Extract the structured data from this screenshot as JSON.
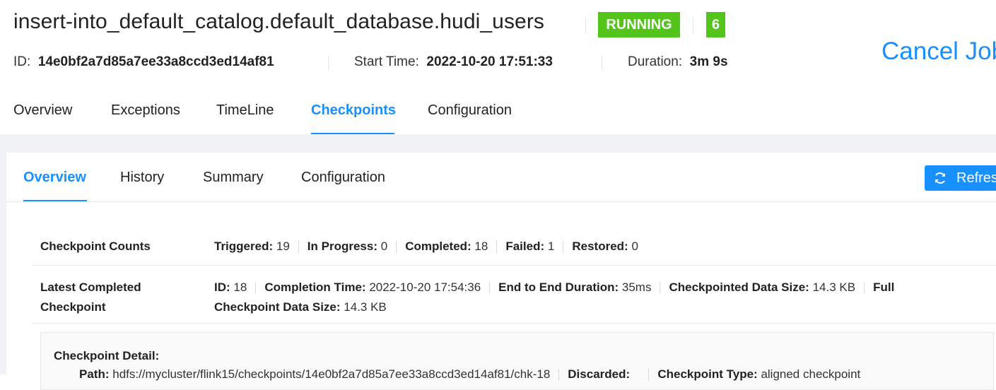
{
  "job": {
    "title": "insert-into_default_catalog.default_database.hudi_users",
    "status": "RUNNING",
    "parallelism": "6",
    "id_label": "ID:",
    "id_value": "14e0bf2a7d85a7ee33a8ccd3ed14af81",
    "start_label": "Start Time:",
    "start_value": "2022-10-20 17:51:33",
    "duration_label": "Duration:",
    "duration_value": "3m 9s",
    "cancel_label": "Cancel Job",
    "status_color": "#52c41a"
  },
  "tabs": [
    "Overview",
    "Exceptions",
    "TimeLine",
    "Checkpoints",
    "Configuration"
  ],
  "active_tab": "Checkpoints",
  "subtabs": [
    "Overview",
    "History",
    "Summary",
    "Configuration"
  ],
  "active_subtab": "Overview",
  "refresh_label": "Refresh",
  "counts": {
    "label": "Checkpoint Counts",
    "triggered_label": "Triggered:",
    "triggered": "19",
    "in_progress_label": "In Progress:",
    "in_progress": "0",
    "completed_label": "Completed:",
    "completed": "18",
    "failed_label": "Failed:",
    "failed": "1",
    "restored_label": "Restored:",
    "restored": "0"
  },
  "latest": {
    "label_line1": "Latest Completed",
    "label_line2": "Checkpoint",
    "id_label": "ID:",
    "id": "18",
    "completion_label": "Completion Time:",
    "completion": "2022-10-20 17:54:36",
    "e2e_label": "End to End Duration:",
    "e2e": "35ms",
    "size_label": "Checkpointed Data Size:",
    "size": "14.3 KB",
    "full_label_1": "Full",
    "full_label_2": "Checkpoint Data Size:",
    "full_size": "14.3 KB"
  },
  "detail": {
    "heading": "Checkpoint Detail:",
    "path_label": "Path:",
    "path_value": "hdfs://mycluster/flink15/checkpoints/14e0bf2a7d85a7ee33a8ccd3ed14af81/chk-18",
    "discarded_label": "Discarded:",
    "type_label": "Checkpoint Type:",
    "type_value": "aligned checkpoint"
  },
  "colors": {
    "accent": "#1890ff",
    "success": "#52c41a",
    "background": "#f0f2f5"
  }
}
